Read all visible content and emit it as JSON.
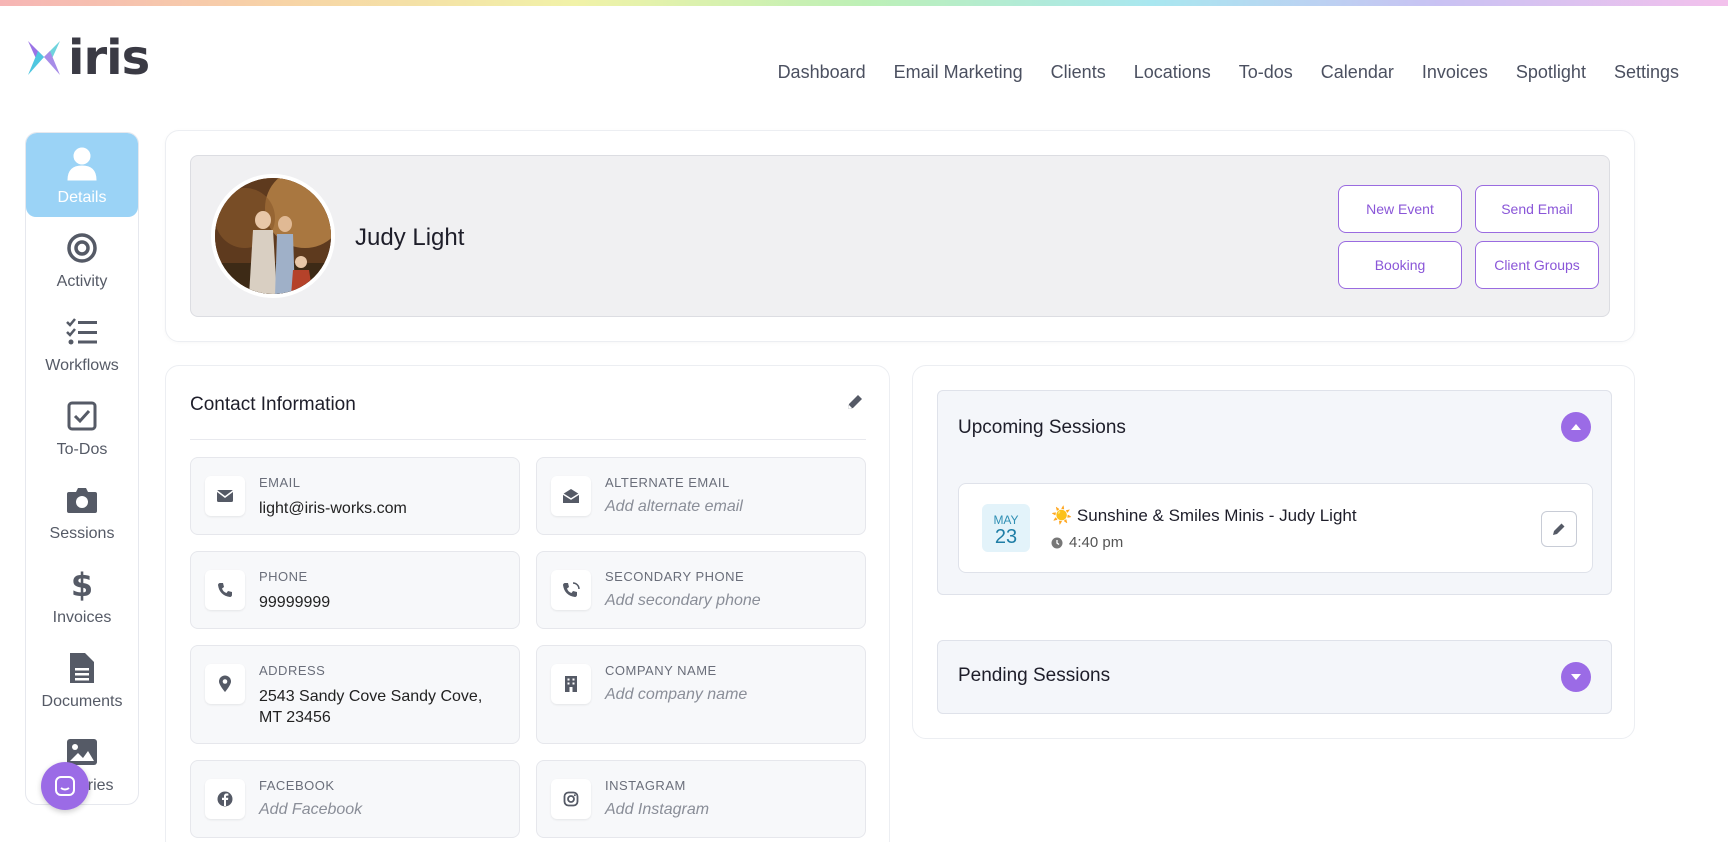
{
  "app": {
    "logo_text": "iris"
  },
  "topnav": [
    "Dashboard",
    "Email Marketing",
    "Clients",
    "Locations",
    "To-dos",
    "Calendar",
    "Invoices",
    "Spotlight",
    "Settings"
  ],
  "sidenav": [
    "Details",
    "Activity",
    "Workflows",
    "To-Dos",
    "Sessions",
    "Invoices",
    "Documents",
    "Galleries"
  ],
  "profile": {
    "name": "Judy Light",
    "buttons": {
      "new_event": "New Event",
      "send_email": "Send Email",
      "booking": "Booking",
      "client_groups": "Client Groups"
    }
  },
  "contact": {
    "title": "Contact Information",
    "email_label": "EMAIL",
    "email_value": "light@iris-works.com",
    "alt_email_label": "ALTERNATE EMAIL",
    "alt_email_placeholder": "Add alternate email",
    "phone_label": "PHONE",
    "phone_value": "99999999",
    "secondary_phone_label": "SECONDARY PHONE",
    "secondary_phone_placeholder": "Add secondary phone",
    "address_label": "ADDRESS",
    "address_value": "2543 Sandy Cove Sandy Cove, MT 23456",
    "company_label": "COMPANY NAME",
    "company_placeholder": "Add company name",
    "facebook_label": "FACEBOOK",
    "facebook_placeholder": "Add Facebook",
    "instagram_label": "INSTAGRAM",
    "instagram_placeholder": "Add Instagram"
  },
  "sessions": {
    "upcoming_title": "Upcoming Sessions",
    "pending_title": "Pending Sessions",
    "event": {
      "month": "MAY",
      "day": "23",
      "emoji": "☀️",
      "title": "Sunshine & Smiles Minis - Judy Light",
      "time": "4:40 pm"
    }
  },
  "colors": {
    "accent": "#9b6be6",
    "active_nav": "#9bd3f6"
  }
}
